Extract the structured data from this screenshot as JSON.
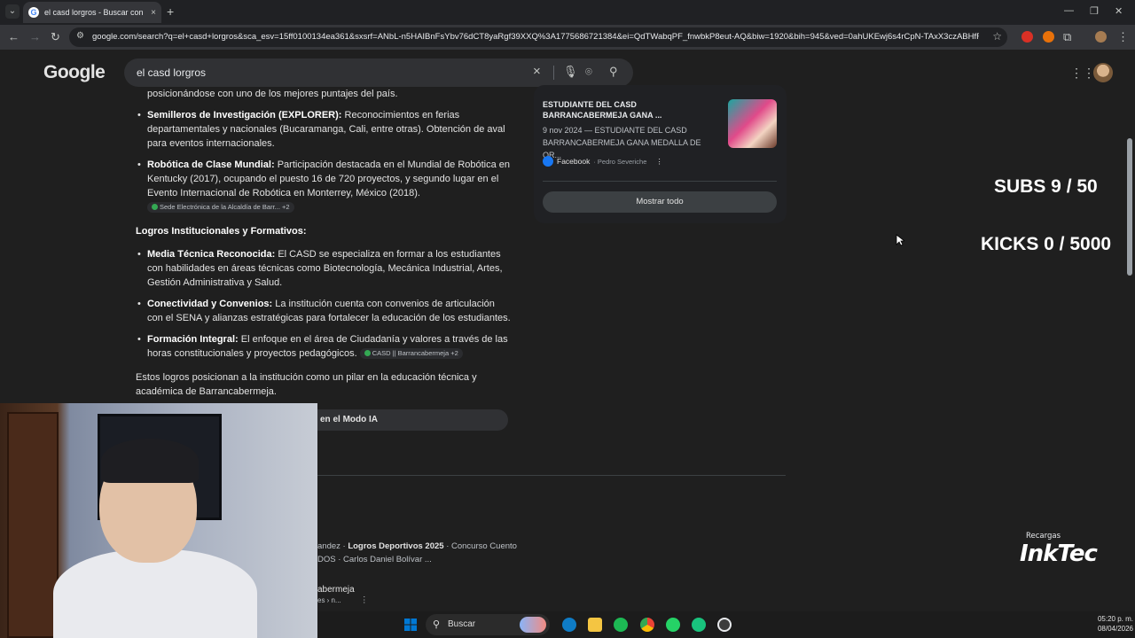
{
  "browser": {
    "tab_title": "el casd lorgros - Buscar con Go",
    "tab_close": "×",
    "new_tab": "+",
    "menu": "⌄",
    "url": "google.com/search?q=el+casd+lorgros&sca_esv=15ff0100134ea361&sxsrf=ANbL-n5HAIBnFsYbv76dCT8yaRgf39XXQ%3A1775686721384&ei=QdTWabqPF_fnwbkP8eut-AQ&biw=1920&bih=945&ved=0ahUKEwj6s4rCpN-TAxX3czABHfF1C08Q..."
  },
  "google": {
    "logo": "Google",
    "query": "el casd lorgros",
    "clear_icon": "×"
  },
  "content": {
    "cut_line": "posicionándose con uno de los mejores puntajes del país.",
    "bullets_top": [
      {
        "title": "Semilleros de Investigación (EXPLORER):",
        "text": " Reconocimientos en ferias departamentales y nacionales (Bucaramanga, Cali, entre otras). Obtención de aval para eventos internacionales."
      },
      {
        "title": "Robótica de Clase Mundial:",
        "text": " Participación destacada en el Mundial de Robótica en Kentucky (2017), ocupando el puesto 16 de 720 proyectos, y segundo lugar en el Evento Internacional de Robótica en Monterrey, México (2018).",
        "source": "Sede Electrónica de la Alcaldía de Barr... +2"
      }
    ],
    "section_heading": "Logros Institucionales y Formativos:",
    "bullets_bottom": [
      {
        "title": "Media Técnica Reconocida:",
        "text": " El CASD se especializa en formar a los estudiantes con habilidades en áreas técnicas como Biotecnología, Mecánica Industrial, Artes, Gestión Administrativa y Salud."
      },
      {
        "title": "Conectividad y Convenios:",
        "text": " La institución cuenta con convenios de articulación con el SENA y alianzas estratégicas para fortalecer la educación de los estudiantes."
      },
      {
        "title": "Formación Integral:",
        "text": " El enfoque en el área de Ciudadanía y valores a través de las horas constitucionales y proyectos pedagógicos.",
        "source": "CASD || Barrancabermeja +2"
      }
    ],
    "closing": "Estos logros posicionan a la institución como un pilar en la educación técnica y académica de Barrancabermeja.",
    "ai_mode_button": "en el Modo IA",
    "related_line1_pre": "andez · ",
    "related_line1_bold": "Logros Deportivos 2025",
    "related_line1_post": " · Concurso Cuento",
    "related_line2": "DOS · Carlos Daniel Bolívar ...",
    "related_title": "abermeja",
    "related_sub": "es › n...",
    "related_more": "⋮"
  },
  "panel": {
    "title": "ESTUDIANTE DEL CASD BARRANCABERMEJA GANA ...",
    "desc": "9 nov 2024 — ESTUDIANTE DEL CASD BARRANCABERMEJA GANA MEDALLA DE OR...",
    "source": "Facebook",
    "author": "· Pedro Severiche",
    "more": "⋮",
    "show_all": "Mostrar todo"
  },
  "overlay": {
    "subs": "SUBS 9 / 50",
    "kicks": "KICKS 0 / 5000",
    "logo_small": "Recargas",
    "logo_big": "InkTec"
  },
  "taskbar": {
    "search_label": "Buscar",
    "time": "05:20 p. m.",
    "date": "08/04/2026"
  },
  "colors": {
    "page_bg": "#1f1f1f",
    "search_bg": "#303134",
    "windows_blue": "#0078d4",
    "spotify_green": "#1db954",
    "facebook_blue": "#1877f2"
  }
}
